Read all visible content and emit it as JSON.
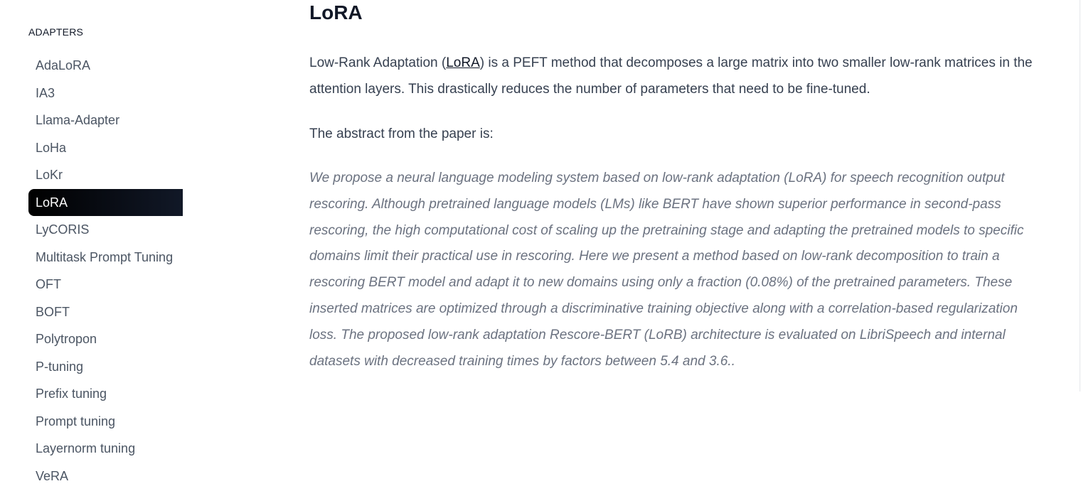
{
  "sidebar": {
    "section_title": "ADAPTERS",
    "items": [
      {
        "label": "AdaLoRA"
      },
      {
        "label": "IA3"
      },
      {
        "label": "Llama-Adapter"
      },
      {
        "label": "LoHa"
      },
      {
        "label": "LoKr"
      },
      {
        "label": "LoRA",
        "active": true
      },
      {
        "label": "LyCORIS"
      },
      {
        "label": "Multitask Prompt Tuning"
      },
      {
        "label": "OFT"
      },
      {
        "label": "BOFT"
      },
      {
        "label": "Polytropon"
      },
      {
        "label": "P-tuning"
      },
      {
        "label": "Prefix tuning"
      },
      {
        "label": "Prompt tuning"
      },
      {
        "label": "Layernorm tuning"
      },
      {
        "label": "VeRA"
      }
    ]
  },
  "main": {
    "title": "LoRA",
    "intro": {
      "before_link": "Low-Rank Adaptation (",
      "link_text": "LoRA",
      "after_link": ") is a PEFT method that decomposes a large matrix into two smaller low-rank matrices in the attention layers. This drastically reduces the number of parameters that need to be fine-tuned."
    },
    "abstract_lead": "The abstract from the paper is:",
    "abstract": "We propose a neural language modeling system based on low-rank adaptation (LoRA) for speech recognition output rescoring. Although pretrained language models (LMs) like BERT have shown superior performance in second-pass rescoring, the high computational cost of scaling up the pretraining stage and adapting the pretrained models to specific domains limit their practical use in rescoring. Here we present a method based on low-rank decomposition to train a rescoring BERT model and adapt it to new domains using only a fraction (0.08%) of the pretrained parameters. These inserted matrices are optimized through a discriminative training objective along with a correlation-based regularization loss. The proposed low-rank adaptation Rescore-BERT (LoRB) architecture is evaluated on LibriSpeech and internal datasets with decreased training times by factors between 5.4 and 3.6.."
  }
}
